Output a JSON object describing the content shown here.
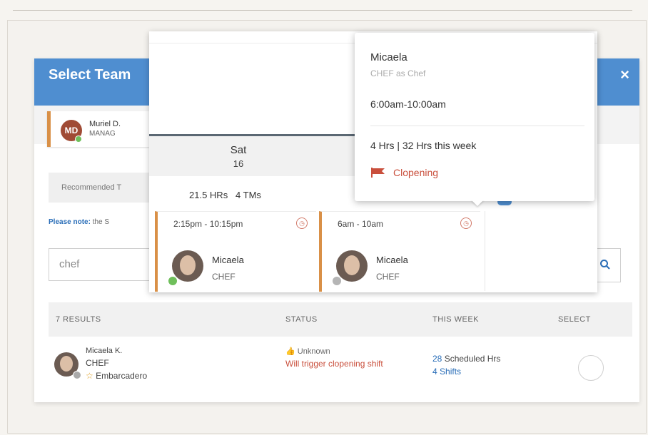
{
  "modal": {
    "title": "Select Team",
    "close_label": "×",
    "manager": {
      "initials": "MD",
      "name": "Muriel D.",
      "role": "MANAG"
    },
    "tab_recommended": "Recommended T",
    "note_label": "Please note:",
    "note_text": "the S",
    "search": {
      "value": "chef"
    },
    "results": {
      "count_label": "7 RESULTS",
      "col_status": "STATUS",
      "col_this_week": "THIS WEEK",
      "col_select": "SELECT",
      "row": {
        "name": "Micaela K.",
        "role": "CHEF",
        "location": "Embarcadero",
        "status_unknown": "Unknown",
        "status_warning": "Will trigger clopening shift",
        "scheduled_num": "28",
        "scheduled_label": "Scheduled Hrs",
        "shifts_num": "4",
        "shifts_label": "Shifts"
      }
    }
  },
  "schedule": {
    "day": "Sat",
    "date": "16",
    "hours_total": "21.5 HRs",
    "tm_count": "4 TMs",
    "shifts": [
      {
        "time": "2:15pm - 10:15pm",
        "name": "Micaela",
        "role": "CHEF",
        "status_color": "#6fbf5b"
      },
      {
        "time": "6am - 10am",
        "name": "Micaela",
        "role": "CHEF",
        "status_color": "#b5b5b5"
      }
    ]
  },
  "tooltip": {
    "name": "Micaela",
    "role": "CHEF as Chef",
    "time": "6:00am-10:00am",
    "hours": "4 Hrs | 32 Hrs this week",
    "flag_label": "Clopening"
  },
  "colors": {
    "header_blue": "#4f8ed0",
    "accent_orange": "#d99047",
    "warning_red": "#c94f3c",
    "link_blue": "#2a6eb8"
  }
}
